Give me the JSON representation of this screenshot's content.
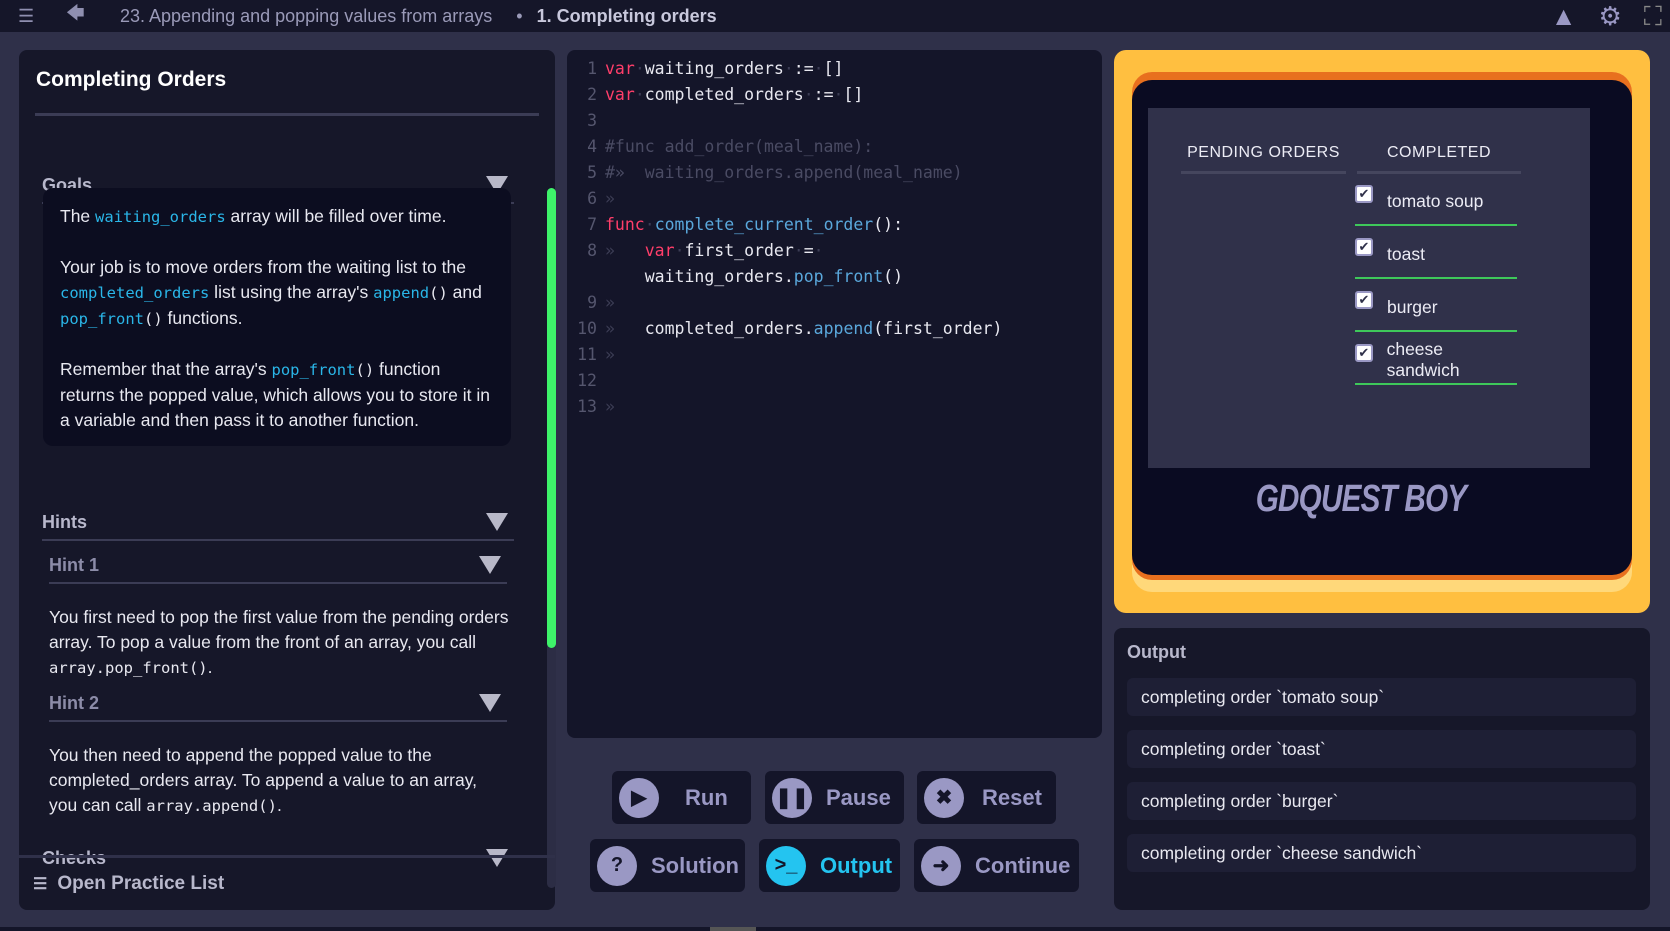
{
  "topbar": {
    "breadcrumb_parent": "23. Appending and popping values from arrays",
    "separator": "•",
    "breadcrumb_current": "1. Completing orders"
  },
  "left": {
    "title": "Completing Orders",
    "goals_label": "Goals",
    "goals": [
      [
        {
          "t": "The "
        },
        {
          "t": "waiting_orders",
          "code": true
        },
        {
          "t": " array will be filled over time."
        }
      ],
      [
        {
          "t": "Your job is to move orders from the waiting list to the "
        },
        {
          "t": "completed_orders",
          "code": true
        },
        {
          "t": " list using the array's "
        },
        {
          "t": "append",
          "code": true
        },
        {
          "t": "()",
          "mono": true
        },
        {
          "t": " and "
        },
        {
          "t": "pop_front",
          "code": true
        },
        {
          "t": "()",
          "mono": true
        },
        {
          "t": " functions."
        }
      ],
      [
        {
          "t": "Remember that the array's "
        },
        {
          "t": "pop_front",
          "code": true
        },
        {
          "t": "()",
          "mono": true
        },
        {
          "t": " function returns the popped value, which allows you to store it in a variable and then pass it to another function."
        }
      ]
    ],
    "hints_label": "Hints",
    "hint1_label": "Hint 1",
    "hint1_text": "You first need to pop the first value from the pending orders array. To pop a value from the front of an array, you call ",
    "hint1_code": "array.pop_front()",
    "hint2_label": "Hint 2",
    "hint2_text": "You then need to append the popped value to the completed_orders array. To append a value to an array, you can call ",
    "hint2_code": "array.append()",
    "period": ".",
    "checks_label": "Checks",
    "open_practice": "Open Practice List"
  },
  "code": [
    {
      "n": "1",
      "tokens": [
        {
          "t": "var",
          "c": "k"
        },
        {
          "t": "·",
          "c": "t"
        },
        {
          "t": "waiting_orders",
          "c": "w"
        },
        {
          "t": "·",
          "c": "t"
        },
        {
          "t": ":=",
          "c": "w"
        },
        {
          "t": "·",
          "c": "t"
        },
        {
          "t": "[]",
          "c": "w"
        }
      ]
    },
    {
      "n": "2",
      "tokens": [
        {
          "t": "var",
          "c": "k"
        },
        {
          "t": "·",
          "c": "t"
        },
        {
          "t": "completed_orders",
          "c": "w"
        },
        {
          "t": "·",
          "c": "t"
        },
        {
          "t": ":=",
          "c": "w"
        },
        {
          "t": "·",
          "c": "t"
        },
        {
          "t": "[]",
          "c": "w"
        }
      ]
    },
    {
      "n": "3",
      "tokens": []
    },
    {
      "n": "4",
      "tokens": [
        {
          "t": "#func add_order(meal_name):",
          "c": "c"
        }
      ]
    },
    {
      "n": "5",
      "tokens": [
        {
          "t": "#»  waiting_orders.append(meal_name)",
          "c": "c"
        }
      ]
    },
    {
      "n": "6",
      "tokens": [
        {
          "t": "»",
          "c": "t"
        }
      ]
    },
    {
      "n": "7",
      "tokens": [
        {
          "t": "func",
          "c": "k"
        },
        {
          "t": "·",
          "c": "t"
        },
        {
          "t": "complete_current_order",
          "c": "f"
        },
        {
          "t": "():",
          "c": "w"
        }
      ]
    },
    {
      "n": "8",
      "tokens": [
        {
          "t": "»   ",
          "c": "t"
        },
        {
          "t": "var",
          "c": "k"
        },
        {
          "t": "·",
          "c": "t"
        },
        {
          "t": "first_order",
          "c": "w"
        },
        {
          "t": "·",
          "c": "t"
        },
        {
          "t": "=",
          "c": "w"
        },
        {
          "t": "·",
          "c": "t"
        }
      ]
    },
    {
      "n": "",
      "tokens": [
        {
          "t": "    ",
          "c": "t"
        },
        {
          "t": "waiting_orders.",
          "c": "w"
        },
        {
          "t": "pop_front",
          "c": "f"
        },
        {
          "t": "()",
          "c": "w"
        }
      ]
    },
    {
      "n": "9",
      "tokens": [
        {
          "t": "»",
          "c": "t"
        }
      ]
    },
    {
      "n": "10",
      "tokens": [
        {
          "t": "»   ",
          "c": "t"
        },
        {
          "t": "completed_orders.",
          "c": "w"
        },
        {
          "t": "append",
          "c": "f"
        },
        {
          "t": "(first_order)",
          "c": "w"
        }
      ]
    },
    {
      "n": "11",
      "tokens": [
        {
          "t": "»",
          "c": "t"
        }
      ]
    },
    {
      "n": "12",
      "tokens": []
    },
    {
      "n": "13",
      "tokens": [
        {
          "t": "»",
          "c": "t"
        }
      ]
    }
  ],
  "buttons": {
    "run": "Run",
    "pause": "Pause",
    "reset": "Reset",
    "solution": "Solution",
    "output": "Output",
    "continue": "Continue"
  },
  "game": {
    "pending_header": "PENDING ORDERS",
    "completed_header": "COMPLETED",
    "completed": [
      "tomato soup",
      "toast",
      "burger",
      "cheese sandwich"
    ],
    "logo": "GDQUEST BOY"
  },
  "output": {
    "title": "Output",
    "lines": [
      "completing order `tomato soup`",
      "completing order `toast`",
      "completing order `burger`",
      "completing order `cheese sandwich`"
    ]
  },
  "colors": {
    "accent": "#24c4f0",
    "game_frame": "#ffbf40",
    "scroll": "#3ef36a",
    "keyword": "#ff3e6a"
  }
}
